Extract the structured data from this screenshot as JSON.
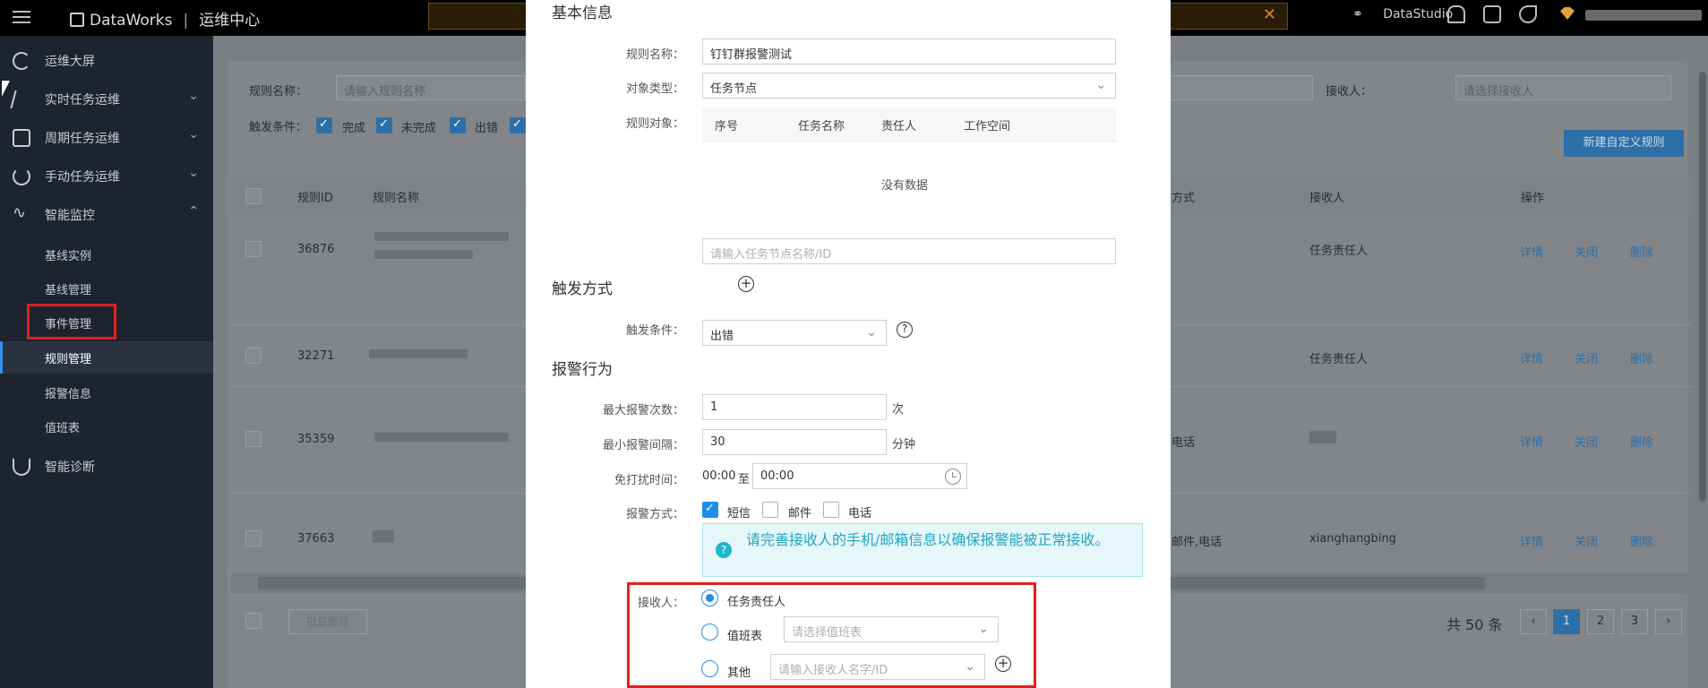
{
  "topbar": {
    "brand": "DataWorks",
    "section": "运维中心",
    "studio_link": "DataStudio",
    "icons": [
      "bell-icon",
      "question-icon",
      "wrench-icon",
      "gem-icon"
    ]
  },
  "sidebar": {
    "items": [
      {
        "label": "运维大屏",
        "icon": "dashboard-icon"
      },
      {
        "label": "实时任务运维",
        "icon": "realtime-icon",
        "expandable": true
      },
      {
        "label": "周期任务运维",
        "icon": "cycle-icon",
        "expandable": true
      },
      {
        "label": "手动任务运维",
        "icon": "manual-icon",
        "expandable": true
      },
      {
        "label": "智能监控",
        "icon": "monitor-icon",
        "expanded": true
      },
      {
        "label": "智能诊断",
        "icon": "diagnose-icon"
      }
    ],
    "sub_items": [
      "基线实例",
      "基线管理",
      "事件管理",
      "规则管理",
      "报警信息",
      "值班表"
    ],
    "active_sub": "规则管理"
  },
  "filters": {
    "rule_name_label": "规则名称：",
    "rule_name_placeholder": "请输入规则名称",
    "trigger_label": "触发条件：",
    "trigger_options": [
      "完成",
      "未完成",
      "出错"
    ],
    "receiver_label": "接收人：",
    "receiver_placeholder": "请选择接收人",
    "new_rule_button": "新建自定义规则"
  },
  "table": {
    "columns": [
      "规则ID",
      "规则名称",
      "方式",
      "接收人",
      "操作"
    ],
    "rows": [
      {
        "id": "36876",
        "method": "",
        "receiver": "任务责任人"
      },
      {
        "id": "32271",
        "method": "",
        "receiver": "任务责任人"
      },
      {
        "id": "35359",
        "method": "电话",
        "receiver": ""
      },
      {
        "id": "37663",
        "method": "邮件,电话",
        "receiver": "xianghangbing"
      }
    ],
    "actions": [
      "详情",
      "关闭",
      "删除"
    ]
  },
  "footer": {
    "batch_delete": "批量删除",
    "total": "共 50 条",
    "pages": [
      "1",
      "2",
      "3"
    ],
    "current_page": "1"
  },
  "modal": {
    "basic_section": "基本信息",
    "rule_name_label": "规则名称：",
    "rule_name_value": "钉钉群报警测试",
    "object_type_label": "对象类型：",
    "object_type_value": "任务节点",
    "rule_object_label": "规则对象：",
    "object_columns": [
      "序号",
      "任务名称",
      "责任人",
      "工作空间"
    ],
    "no_data": "没有数据",
    "node_placeholder": "请输入任务节点名称/ID",
    "trigger_section": "触发方式",
    "trigger_label": "触发条件：",
    "trigger_value": "出错",
    "alert_section": "报警行为",
    "max_alerts_label": "最大报警次数：",
    "max_alerts_value": "1",
    "max_alerts_unit": "次",
    "min_interval_label": "最小报警间隔：",
    "min_interval_value": "30",
    "min_interval_unit": "分钟",
    "dnd_label": "免打扰时间：",
    "dnd_start": "00:00",
    "dnd_to": "至",
    "dnd_end": "00:00",
    "method_label": "报警方式：",
    "methods": [
      {
        "label": "短信",
        "checked": true
      },
      {
        "label": "邮件",
        "checked": false
      },
      {
        "label": "电话",
        "checked": false
      }
    ],
    "notice": "请完善接收人的手机/邮箱信息以确保报警能被正常接收。",
    "receiver_label": "接收人：",
    "receiver_options": [
      {
        "label": "任务责任人",
        "selected": true
      },
      {
        "label": "值班表",
        "selected": false,
        "placeholder": "请选择值班表"
      },
      {
        "label": "其他",
        "selected": false,
        "placeholder": "请输入接收人名字/ID"
      }
    ]
  },
  "colors": {
    "accent": "#1e8ee6",
    "highlight_box": "#e0201b",
    "sidebar_bg": "#1d2430",
    "notice_text": "#1fa7c2"
  }
}
